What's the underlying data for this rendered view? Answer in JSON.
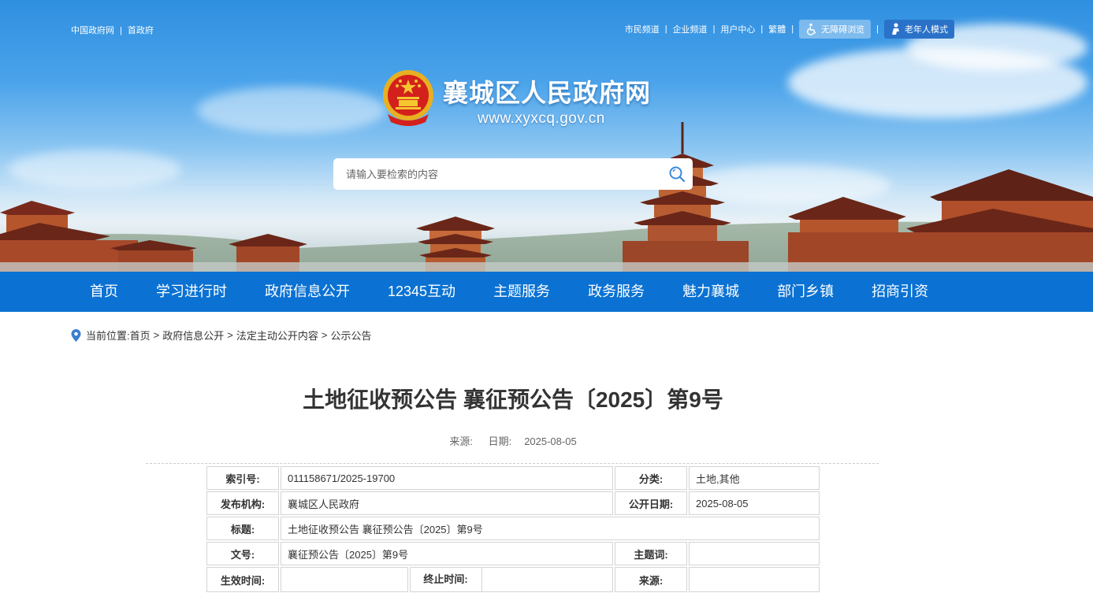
{
  "top_links_left": [
    "中国政府网",
    "首政府"
  ],
  "top_links_right": [
    "市民频道",
    "企业频道",
    "用户中心",
    "繁體"
  ],
  "accessibility_label": "无障碍浏览",
  "elder_mode_label": "老年人模式",
  "site": {
    "title": "襄城区人民政府网",
    "url": "www.xyxcq.gov.cn"
  },
  "search": {
    "placeholder": "请输入要检索的内容"
  },
  "nav": [
    "首页",
    "学习进行时",
    "政府信息公开",
    "12345互动",
    "主题服务",
    "政务服务",
    "魅力襄城",
    "部门乡镇",
    "招商引资"
  ],
  "breadcrumb": {
    "prefix": "当前位置:",
    "items": [
      "首页",
      "政府信息公开",
      "法定主动公开内容",
      "公示公告"
    ]
  },
  "article": {
    "title": "土地征收预公告 襄征预公告〔2025〕第9号",
    "source_label": "来源:",
    "date_label": "日期:",
    "date": "2025-08-05"
  },
  "info": {
    "index_label": "索引号:",
    "index": "011158671/2025-19700",
    "category_label": "分类:",
    "category": "土地,其他",
    "publisher_label": "发布机构:",
    "publisher": "襄城区人民政府",
    "pub_date_label": "公开日期:",
    "pub_date": "2025-08-05",
    "title_label": "标题:",
    "title": "土地征收预公告 襄征预公告〔2025〕第9号",
    "doc_no_label": "文号:",
    "doc_no": "襄征预公告〔2025〕第9号",
    "subject_label": "主题词:",
    "subject": "",
    "effective_label": "生效时间:",
    "effective": "",
    "expire_label": "终止时间:",
    "expire": "",
    "source_label": "来源:",
    "source": ""
  },
  "colors": {
    "nav_bg": "#0b72d3",
    "elder_btn": "#2a72c8"
  }
}
